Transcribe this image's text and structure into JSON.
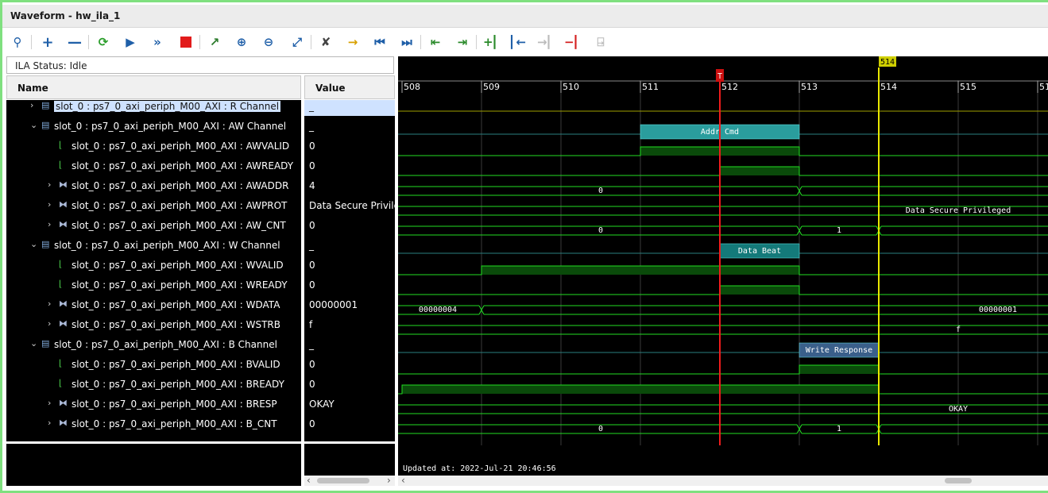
{
  "window": {
    "title": "Waveform - hw_ila_1"
  },
  "toolbar": {
    "icons": [
      "search-icon",
      "add-icon",
      "remove-icon",
      "refresh-icon",
      "run-trigger-icon",
      "run-immediate-icon",
      "stop-icon",
      "export-icon",
      "zoom-in-icon",
      "zoom-out-icon",
      "zoom-fit-icon",
      "cursor-snap-icon",
      "add-marker-icon",
      "go-to-start-icon",
      "go-to-end-icon",
      "previous-transition-icon",
      "next-transition-icon",
      "add-marker-plus-icon",
      "previous-marker-icon",
      "next-marker-icon",
      "delete-marker-icon",
      "swap-cursor-icon"
    ]
  },
  "status": {
    "text": "ILA Status:  Idle"
  },
  "columns": {
    "name": "Name",
    "value": "Value"
  },
  "signals": [
    {
      "name": "slot_0 : ps7_0_axi_periph_M00_AXI : R Channel",
      "value": "_",
      "indent": 0,
      "type": "bus",
      "chevron": "›",
      "selected": true
    },
    {
      "name": "slot_0 : ps7_0_axi_periph_M00_AXI : AW Channel",
      "value": "_",
      "indent": 0,
      "type": "bus",
      "chevron": "⌄"
    },
    {
      "name": "slot_0 : ps7_0_axi_periph_M00_AXI : AWVALID",
      "value": "0",
      "indent": 1,
      "type": "bit",
      "chevron": ""
    },
    {
      "name": "slot_0 : ps7_0_axi_periph_M00_AXI : AWREADY",
      "value": "0",
      "indent": 1,
      "type": "bit",
      "chevron": ""
    },
    {
      "name": "slot_0 : ps7_0_axi_periph_M00_AXI : AWADDR",
      "value": "4",
      "indent": 1,
      "type": "vec",
      "chevron": "›"
    },
    {
      "name": "slot_0 : ps7_0_axi_periph_M00_AXI : AWPROT",
      "value": "Data Secure Privileged",
      "indent": 1,
      "type": "vec",
      "chevron": "›"
    },
    {
      "name": "slot_0 : ps7_0_axi_periph_M00_AXI : AW_CNT",
      "value": "0",
      "indent": 1,
      "type": "vec",
      "chevron": "›"
    },
    {
      "name": "slot_0 : ps7_0_axi_periph_M00_AXI : W Channel",
      "value": "_",
      "indent": 0,
      "type": "bus",
      "chevron": "⌄"
    },
    {
      "name": "slot_0 : ps7_0_axi_periph_M00_AXI : WVALID",
      "value": "0",
      "indent": 1,
      "type": "bit",
      "chevron": ""
    },
    {
      "name": "slot_0 : ps7_0_axi_periph_M00_AXI : WREADY",
      "value": "0",
      "indent": 1,
      "type": "bit",
      "chevron": ""
    },
    {
      "name": "slot_0 : ps7_0_axi_periph_M00_AXI : WDATA",
      "value": "00000001",
      "indent": 1,
      "type": "vec",
      "chevron": "›"
    },
    {
      "name": "slot_0 : ps7_0_axi_periph_M00_AXI : WSTRB",
      "value": "f",
      "indent": 1,
      "type": "vec",
      "chevron": "›"
    },
    {
      "name": "slot_0 : ps7_0_axi_periph_M00_AXI : B Channel",
      "value": "_",
      "indent": 0,
      "type": "bus",
      "chevron": "⌄"
    },
    {
      "name": "slot_0 : ps7_0_axi_periph_M00_AXI : BVALID",
      "value": "0",
      "indent": 1,
      "type": "bit",
      "chevron": ""
    },
    {
      "name": "slot_0 : ps7_0_axi_periph_M00_AXI : BREADY",
      "value": "0",
      "indent": 1,
      "type": "bit",
      "chevron": ""
    },
    {
      "name": "slot_0 : ps7_0_axi_periph_M00_AXI : BRESP",
      "value": "OKAY",
      "indent": 1,
      "type": "vec",
      "chevron": "›"
    },
    {
      "name": "slot_0 : ps7_0_axi_periph_M00_AXI : B_CNT",
      "value": "0",
      "indent": 1,
      "type": "vec",
      "chevron": "›"
    }
  ],
  "waveform": {
    "ticks": [
      "508",
      "509",
      "510",
      "511",
      "512",
      "513",
      "514",
      "515",
      "51"
    ],
    "time_range": [
      508,
      516.1
    ],
    "trigger_marker": {
      "time": 512,
      "label": "T"
    },
    "cursor": {
      "time": 514,
      "label": "514"
    },
    "updated": "Updated at: 2022-Jul-21 20:46:56",
    "tracks": [
      {
        "kind": "line"
      },
      {
        "kind": "txn",
        "segments": [
          {
            "start": 511,
            "end": 513,
            "label": "Addr Cmd",
            "color": "#2a9d9d"
          }
        ]
      },
      {
        "kind": "bit",
        "high": [
          [
            511,
            513
          ]
        ]
      },
      {
        "kind": "bit",
        "high": [
          [
            512,
            513
          ]
        ]
      },
      {
        "kind": "bus",
        "trans": [
          513
        ],
        "labels": [
          {
            "t": 510.5,
            "text": "0"
          }
        ]
      },
      {
        "kind": "bus",
        "trans": [],
        "labels": [
          {
            "t": 515,
            "text": "Data Secure Privileged"
          }
        ]
      },
      {
        "kind": "bus",
        "trans": [
          513,
          514
        ],
        "labels": [
          {
            "t": 510.5,
            "text": "0"
          },
          {
            "t": 513.5,
            "text": "1"
          }
        ]
      },
      {
        "kind": "txn",
        "segments": [
          {
            "start": 512,
            "end": 513,
            "label": "Data Beat",
            "color": "#147a7a"
          }
        ]
      },
      {
        "kind": "bit",
        "high": [
          [
            509,
            513
          ]
        ]
      },
      {
        "kind": "bit",
        "high": [
          [
            512,
            513
          ]
        ]
      },
      {
        "kind": "bus",
        "trans": [
          509
        ],
        "labels": [
          {
            "t": 508.45,
            "text": "00000004"
          },
          {
            "t": 515.5,
            "text": "00000001"
          }
        ]
      },
      {
        "kind": "bus",
        "trans": [],
        "labels": [
          {
            "t": 515,
            "text": "f"
          }
        ]
      },
      {
        "kind": "txn",
        "segments": [
          {
            "start": 513,
            "end": 514,
            "label": "Write Response",
            "color": "#3a5f8a"
          }
        ]
      },
      {
        "kind": "bit",
        "high": [
          [
            513,
            514
          ]
        ]
      },
      {
        "kind": "bit",
        "high": [
          [
            508,
            514
          ]
        ]
      },
      {
        "kind": "bus",
        "trans": [],
        "labels": [
          {
            "t": 515,
            "text": "OKAY"
          }
        ]
      },
      {
        "kind": "bus",
        "trans": [
          513,
          514
        ],
        "labels": [
          {
            "t": 510.5,
            "text": "0"
          },
          {
            "t": 513.5,
            "text": "1"
          }
        ]
      }
    ]
  },
  "colors": {
    "accent_green": "#22dd22",
    "trigger": "#ee1c1c",
    "cursor": "#e8e800",
    "selection": "#cfe2ff"
  }
}
